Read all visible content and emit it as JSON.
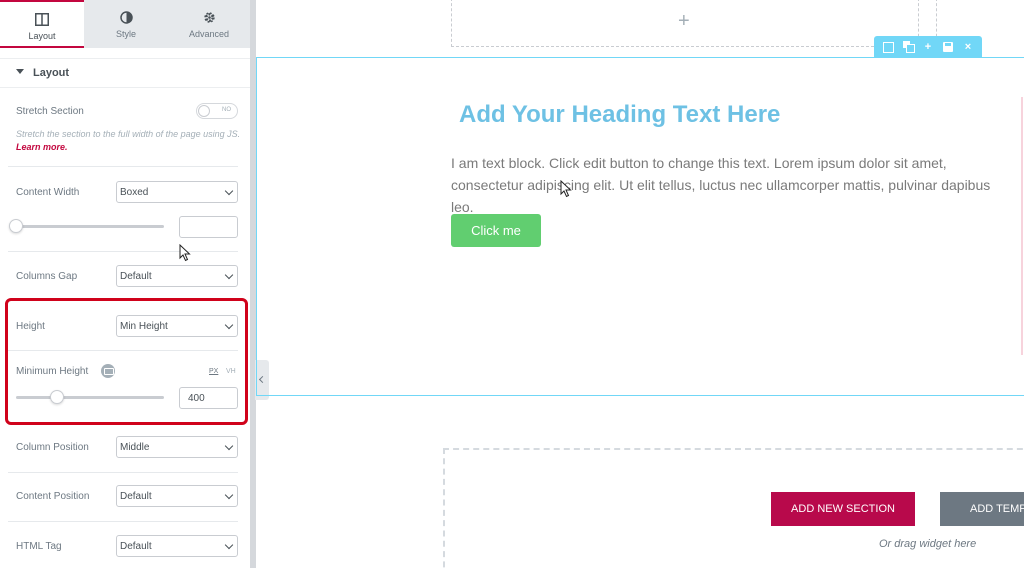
{
  "panel": {
    "tabs": [
      {
        "label": "Layout",
        "icon": "columns-icon",
        "active": true
      },
      {
        "label": "Style",
        "icon": "half-circle-icon",
        "active": false
      },
      {
        "label": "Advanced",
        "icon": "gear-icon",
        "active": false
      }
    ],
    "section_title": "Layout",
    "stretch_section": {
      "label": "Stretch Section",
      "toggle_text": "NO",
      "description": "Stretch the section to the full width of the page using JS.",
      "learn_more": "Learn more."
    },
    "content_width": {
      "label": "Content Width",
      "value": "Boxed",
      "input_value": ""
    },
    "columns_gap": {
      "label": "Columns Gap",
      "value": "Default"
    },
    "height": {
      "label": "Height",
      "value": "Min Height"
    },
    "minimum_height": {
      "label": "Minimum Height",
      "unit_px": "PX",
      "unit_vh": "VH",
      "value": "400"
    },
    "column_position": {
      "label": "Column Position",
      "value": "Middle"
    },
    "content_position": {
      "label": "Content Position",
      "value": "Default"
    },
    "html_tag": {
      "label": "HTML Tag",
      "value": "Default"
    }
  },
  "canvas": {
    "heading": "Add Your Heading Text Here",
    "body_text": "I am text block. Click edit button to change this text. Lorem ipsum dolor sit amet, consectetur adipiscing elit. Ut elit tellus, luctus nec ullamcorper mattis, pulvinar dapibus leo.",
    "button_label": "Click me",
    "add_new_section": "ADD NEW SECTION",
    "add_template": "ADD TEMPLATE",
    "drag_hint": "Or drag widget here",
    "toolbar_plus": "+",
    "toolbar_close": "×",
    "placeholder_plus": "+"
  },
  "colors": {
    "accent": "#c3073f",
    "highlight": "#d0021b",
    "section_border": "#71d7f7",
    "heading": "#6ec1e4",
    "button": "#61ce70",
    "add_section": "#b8094b"
  }
}
